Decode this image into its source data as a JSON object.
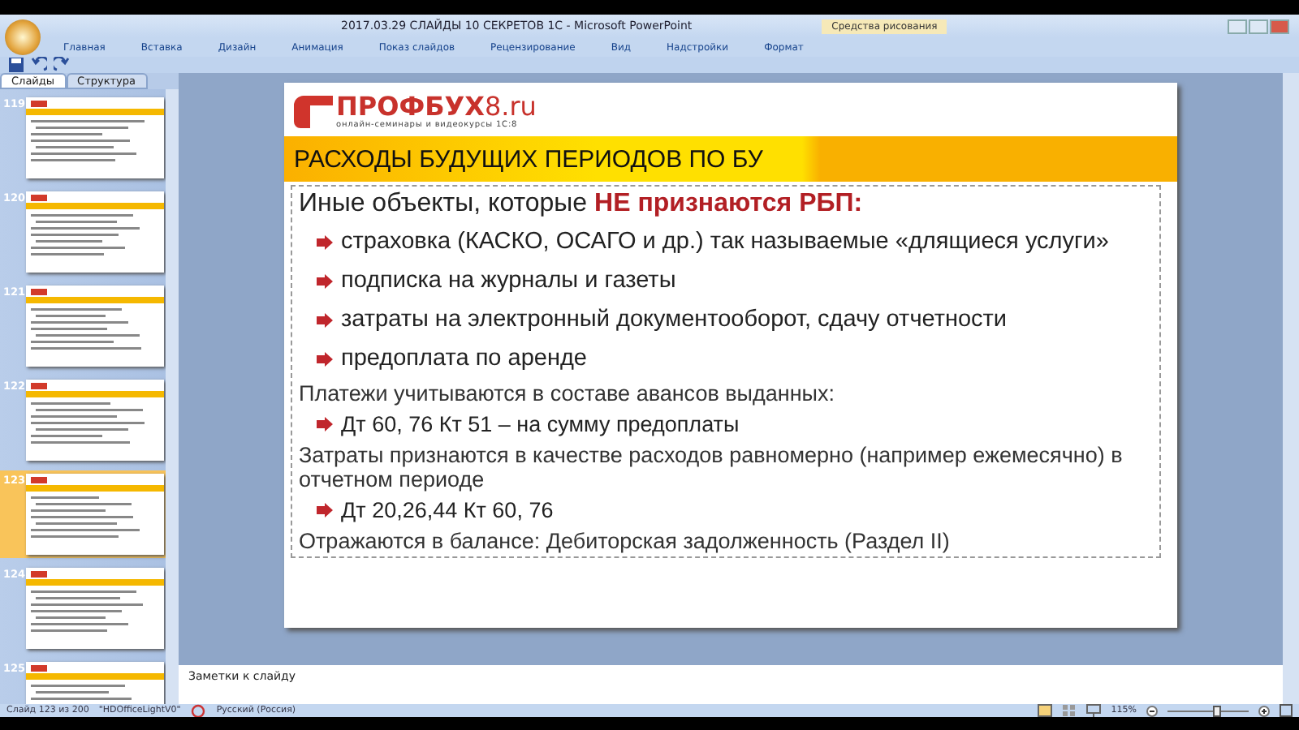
{
  "window": {
    "title": "2017.03.29 СЛАЙДЫ 10 СЕКРЕТОВ 1С - Microsoft PowerPoint",
    "contextual_tab": "Средства рисования"
  },
  "ribbon_tabs": [
    {
      "label": "Главная",
      "selected": false
    },
    {
      "label": "Вставка",
      "selected": false
    },
    {
      "label": "Дизайн",
      "selected": false
    },
    {
      "label": "Анимация",
      "selected": false
    },
    {
      "label": "Показ слайдов",
      "selected": false
    },
    {
      "label": "Рецензирование",
      "selected": false
    },
    {
      "label": "Вид",
      "selected": false
    },
    {
      "label": "Надстройки",
      "selected": false
    },
    {
      "label": "Формат",
      "selected": false
    }
  ],
  "pane_tabs": [
    {
      "label": "Слайды",
      "selected": true
    },
    {
      "label": "Структура",
      "selected": false
    }
  ],
  "thumbnails": [
    {
      "number": "119",
      "selected": false
    },
    {
      "number": "120",
      "selected": false
    },
    {
      "number": "121",
      "selected": false
    },
    {
      "number": "122",
      "selected": false
    },
    {
      "number": "123",
      "selected": true
    },
    {
      "number": "124",
      "selected": false
    },
    {
      "number": "125",
      "selected": false
    }
  ],
  "slide": {
    "logo": "ПРОФБУХ",
    "logo_digit": "8.ru",
    "tagline": "онлайн-семинары и видеокурсы 1С:8",
    "title": "РАСХОДЫ БУДУЩИХ ПЕРИОДОВ ПО БУ",
    "lines": [
      {
        "kind": "lead",
        "text": "Иные объекты, которые **НЕ признаются РБП:**"
      },
      {
        "kind": "bullet",
        "text": "страховка (КАСКО, ОСАГО и др.) так называемые «длящиеся услуги»"
      },
      {
        "kind": "bullet",
        "text": "подписка на журналы и газеты"
      },
      {
        "kind": "bullet",
        "text": "затраты на электронный документооборот, сдачу отчетности"
      },
      {
        "kind": "bullet",
        "text": "предоплата по аренде"
      },
      {
        "kind": "text",
        "text": "Платежи учитываются в составе авансов выданных:"
      },
      {
        "kind": "sub",
        "text": "Дт 60, 76 Кт 51 – на сумму предоплаты"
      },
      {
        "kind": "text",
        "text": "Затраты признаются в качестве расходов равномерно (например ежемесячно) в отчетном периоде"
      },
      {
        "kind": "sub",
        "text": "Дт 20,26,44 Кт 60, 76"
      },
      {
        "kind": "text",
        "text": "Отражаются в балансе:  Дебиторская задолженность (Раздел II)"
      }
    ]
  },
  "notes": {
    "placeholder": "Заметки к слайду"
  },
  "status_bar": {
    "slide": "Слайд 123 из 200",
    "theme": "\"HDOfficeLightV0\"",
    "language": "Русский (Россия)",
    "zoom": "115%",
    "level": 0.6
  }
}
